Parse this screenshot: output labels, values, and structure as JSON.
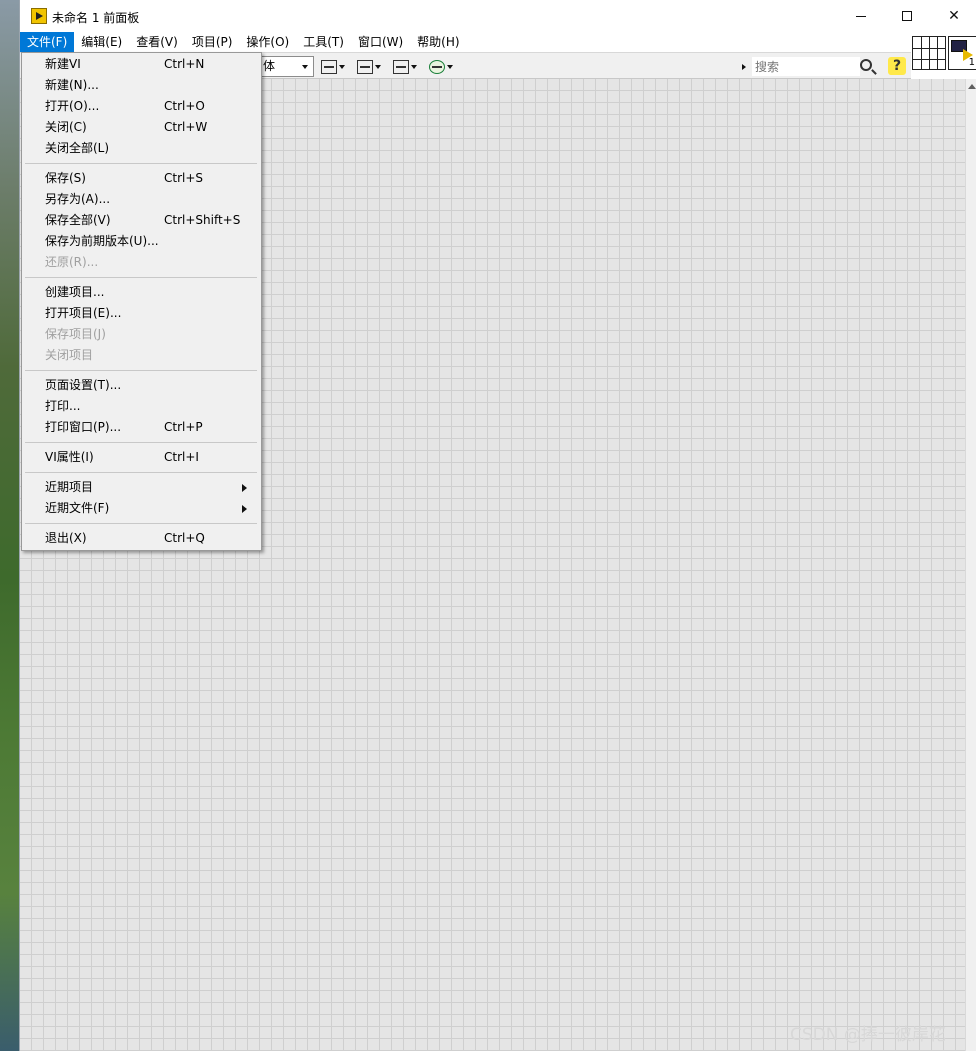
{
  "window": {
    "title": "未命名 1 前面板",
    "min_glyph": "",
    "max_glyph": "",
    "close_glyph": "✕"
  },
  "menubar": [
    "文件(F)",
    "编辑(E)",
    "查看(V)",
    "项目(P)",
    "操作(O)",
    "工具(T)",
    "窗口(W)",
    "帮助(H)"
  ],
  "toolbar": {
    "font_select": "体",
    "search_placeholder": "搜索",
    "help_label": "?"
  },
  "vi_icon": {
    "number": "1"
  },
  "file_menu": {
    "items": [
      {
        "label": "新建VI",
        "shortcut": "Ctrl+N"
      },
      {
        "label": "新建(N)...",
        "shortcut": ""
      },
      {
        "label": "打开(O)...",
        "shortcut": "Ctrl+O"
      },
      {
        "label": "关闭(C)",
        "shortcut": "Ctrl+W"
      },
      {
        "label": "关闭全部(L)",
        "shortcut": ""
      },
      {
        "label": "保存(S)",
        "shortcut": "Ctrl+S"
      },
      {
        "label": "另存为(A)...",
        "shortcut": ""
      },
      {
        "label": "保存全部(V)",
        "shortcut": "Ctrl+Shift+S"
      },
      {
        "label": "保存为前期版本(U)...",
        "shortcut": ""
      },
      {
        "label": "还原(R)...",
        "shortcut": "",
        "disabled": true
      },
      {
        "label": "创建项目...",
        "shortcut": ""
      },
      {
        "label": "打开项目(E)...",
        "shortcut": ""
      },
      {
        "label": "保存项目(J)",
        "shortcut": "",
        "disabled": true
      },
      {
        "label": "关闭项目",
        "shortcut": "",
        "disabled": true
      },
      {
        "label": "页面设置(T)...",
        "shortcut": ""
      },
      {
        "label": "打印...",
        "shortcut": ""
      },
      {
        "label": "打印窗口(P)...",
        "shortcut": "Ctrl+P"
      },
      {
        "label": "VI属性(I)",
        "shortcut": "Ctrl+I"
      },
      {
        "label": "近期项目",
        "shortcut": "",
        "submenu": true
      },
      {
        "label": "近期文件(F)",
        "shortcut": "",
        "submenu": true
      },
      {
        "label": "退出(X)",
        "shortcut": "Ctrl+Q"
      }
    ]
  },
  "watermark": "CSDN @捧一彼岸花",
  "colors": {
    "menu_highlight": "#0078d7",
    "grid_background": "#e5e5e5",
    "grid_line": "#cfcfcf",
    "disabled_text": "#a0a0a0"
  }
}
